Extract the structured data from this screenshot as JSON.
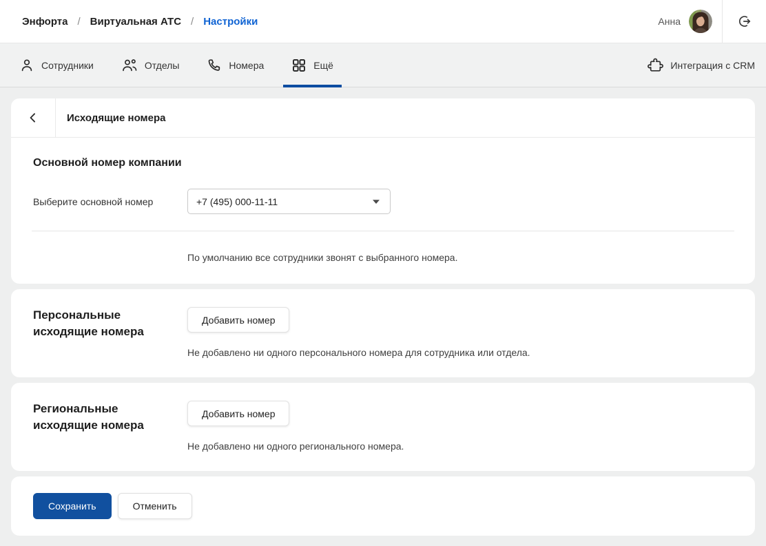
{
  "header": {
    "breadcrumb": [
      {
        "label": "Энфорта",
        "active": false
      },
      {
        "label": "Виртуальная АТС",
        "active": false
      },
      {
        "label": "Настройки",
        "active": true
      }
    ],
    "separator": "/",
    "user_name": "Анна"
  },
  "tabs": {
    "items": [
      {
        "label": "Сотрудники",
        "icon": "person-icon",
        "active": false
      },
      {
        "label": "Отделы",
        "icon": "people-icon",
        "active": false
      },
      {
        "label": "Номера",
        "icon": "phone-icon",
        "active": false
      },
      {
        "label": "Ещё",
        "icon": "grid-icon",
        "active": true
      }
    ],
    "right_item": {
      "label": "Интеграция с CRM",
      "icon": "puzzle-icon"
    }
  },
  "page": {
    "title": "Исходящие номера"
  },
  "main_number": {
    "heading": "Основной номер компании",
    "select_label": "Выберите основной номер",
    "select_value": "+7 (495) 000-11-11",
    "help_text": "По умолчанию все сотрудники звонят с выбранного номера."
  },
  "personal_numbers": {
    "heading_line1": "Персональные",
    "heading_line2": "исходящие номера",
    "add_button_label": "Добавить номер",
    "empty_text": "Не добавлено ни одного персонального номера для сотрудника или отдела."
  },
  "regional_numbers": {
    "heading_line1": "Региональные",
    "heading_line2": "исходящие номера",
    "add_button_label": "Добавить номер",
    "empty_text": "Не добавлено ни одного регионального номера."
  },
  "actions": {
    "save_label": "Сохранить",
    "cancel_label": "Отменить"
  },
  "icons": [
    "person-icon",
    "people-icon",
    "phone-icon",
    "grid-icon",
    "puzzle-icon",
    "logout-icon",
    "back-chevron-icon",
    "caret-down-icon",
    "avatar"
  ],
  "colors": {
    "breadcrumb_link": "#0f63d3",
    "active_tab_underline": "#0d4da1",
    "primary_button": "#11509f"
  }
}
